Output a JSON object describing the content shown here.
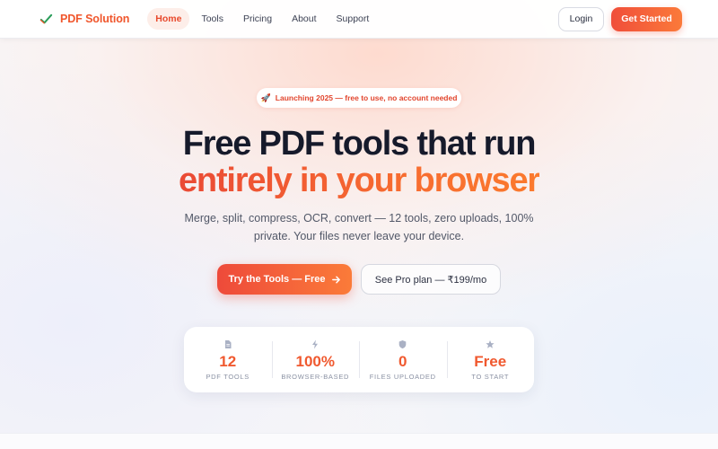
{
  "brand": {
    "name": "PDF Solution",
    "icon": "checkmark-logo-icon"
  },
  "nav": {
    "links": [
      {
        "label": "Home",
        "active": true
      },
      {
        "label": "Tools",
        "active": false
      },
      {
        "label": "Pricing",
        "active": false
      },
      {
        "label": "About",
        "active": false
      },
      {
        "label": "Support",
        "active": false
      }
    ],
    "login_label": "Login",
    "get_started_label": "Get Started"
  },
  "hero": {
    "badge_icon": "rocket-icon",
    "badge_text": "Launching 2025 — free to use, no account needed",
    "headline_line1": "Free PDF tools that run",
    "headline_line2": "entirely in your browser",
    "subtitle": "Merge, split, compress, OCR, convert — 12 tools, zero uploads, 100% private. Your files never leave your device.",
    "primary_cta": "Try the Tools — Free",
    "primary_cta_icon": "arrow-right-icon",
    "secondary_cta": "See Pro plan — ₹199/mo"
  },
  "stats": [
    {
      "icon": "document-icon",
      "value": "12",
      "label": "PDF TOOLS"
    },
    {
      "icon": "lightning-icon",
      "value": "100%",
      "label": "BROWSER-BASED"
    },
    {
      "icon": "shield-icon",
      "value": "0",
      "label": "FILES UPLOADED"
    },
    {
      "icon": "star-icon",
      "value": "Free",
      "label": "TO START"
    }
  ],
  "colors": {
    "accent": "#f0562c",
    "accent_gradient_start": "#ee4a3a",
    "accent_gradient_end": "#fb7b39",
    "heading": "#161a2b",
    "body_text": "#525868"
  }
}
